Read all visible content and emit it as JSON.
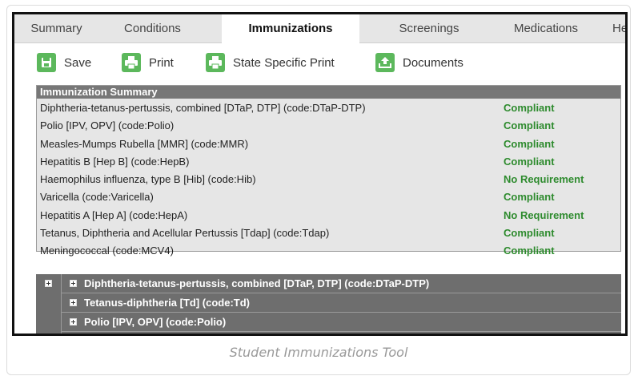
{
  "tabs": [
    {
      "label": "Summary",
      "active": false
    },
    {
      "label": "Conditions",
      "active": false
    },
    {
      "label": "Immunizations",
      "active": true
    },
    {
      "label": "Screenings",
      "active": false
    },
    {
      "label": "Medications",
      "active": false
    },
    {
      "label": "Hea",
      "active": false
    }
  ],
  "toolbar": {
    "save_label": "Save",
    "print_label": "Print",
    "state_print_label": "State Specific Print",
    "documents_label": "Documents"
  },
  "summary": {
    "heading": "Immunization Summary",
    "rows": [
      {
        "name": "Diphtheria-tetanus-pertussis, combined [DTaP, DTP] (code:DTaP-DTP)",
        "status": "Compliant"
      },
      {
        "name": "Polio [IPV, OPV] (code:Polio)",
        "status": "Compliant"
      },
      {
        "name": "Measles-Mumps Rubella [MMR] (code:MMR)",
        "status": "Compliant"
      },
      {
        "name": "Hepatitis B [Hep B] (code:HepB)",
        "status": "Compliant"
      },
      {
        "name": "Haemophilus influenza, type B [Hib] (code:Hib)",
        "status": "No Requirement"
      },
      {
        "name": "Varicella (code:Varicella)",
        "status": "Compliant"
      },
      {
        "name": "Hepatitis A [Hep A] (code:HepA)",
        "status": "No Requirement"
      },
      {
        "name": "Tetanus, Diphtheria and Acellular Pertussis [Tdap] (code:Tdap)",
        "status": "Compliant"
      },
      {
        "name": "Meningococcal (code:MCV4)",
        "status": "Compliant"
      }
    ]
  },
  "tree": {
    "items": [
      {
        "label": "Diphtheria-tetanus-pertussis, combined [DTaP, DTP] (code:DTaP-DTP)"
      },
      {
        "label": "Tetanus-diphtheria [Td] (code:Td)"
      },
      {
        "label": "Polio [IPV, OPV] (code:Polio)"
      }
    ]
  },
  "caption": "Student Immunizations Tool",
  "colors": {
    "accent_green": "#5cb85c",
    "status_green": "#2e8b2e",
    "header_gray": "#777777",
    "tree_gray": "#6e6e6e"
  },
  "icons": [
    "save-icon",
    "print-icon",
    "state-print-icon",
    "documents-upload-icon",
    "expand-plus-icon"
  ]
}
